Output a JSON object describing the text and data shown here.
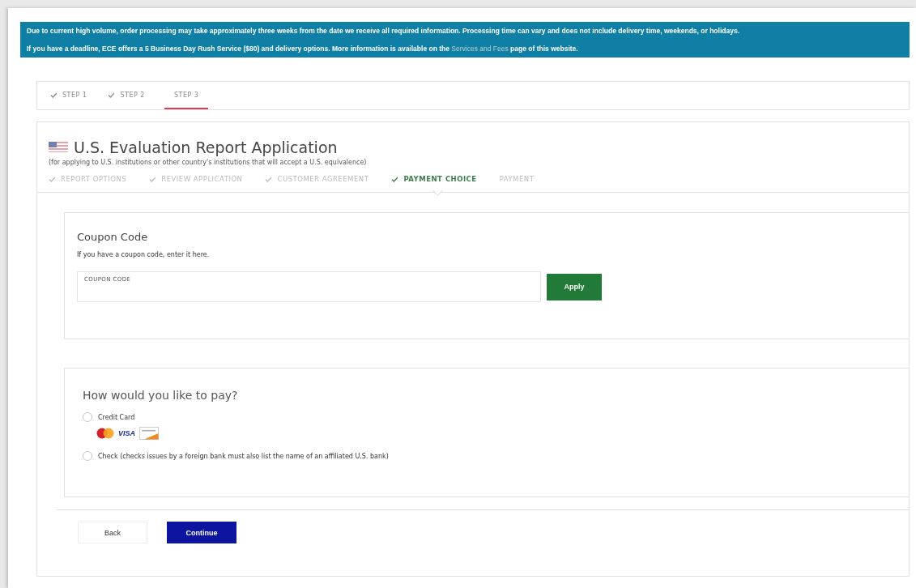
{
  "notice": {
    "lines": [
      [
        {
          "kind": "plain",
          "text": "Due to current high volume, order processing may take approximately three weeks from the date we receive all required information. Processing time can vary and does not include delivery time, weekends, or holidays."
        }
      ],
      [
        {
          "kind": "plain",
          "text": "If you have a deadline, ECE offers a 5 Business Day Rush Service ($80) and delivery options. More information is available on the "
        },
        {
          "kind": "link",
          "text": "Services and Fees"
        },
        {
          "kind": "plain",
          "text": " page of this website."
        }
      ]
    ]
  },
  "steps": [
    {
      "label": "STEP 1",
      "done": true,
      "selected": false
    },
    {
      "label": "STEP 2",
      "done": true,
      "selected": false
    },
    {
      "label": "STEP 3",
      "done": false,
      "selected": true
    }
  ],
  "application": {
    "title": "U.S. Evaluation Report Application",
    "subtitle": "(for applying to U.S. institutions or other country's institutions that will accept a U.S. equivalence)"
  },
  "progress": [
    {
      "label": "REPORT OPTIONS",
      "done": true,
      "selected": false
    },
    {
      "label": "REVIEW APPLICATION",
      "done": true,
      "selected": false
    },
    {
      "label": "CUSTOMER AGREEMENT",
      "done": true,
      "selected": false
    },
    {
      "label": "PAYMENT CHOICE",
      "done": true,
      "selected": true
    },
    {
      "label": "PAYMENT",
      "done": false,
      "selected": false
    }
  ],
  "coupon": {
    "title": "Coupon Code",
    "hint": "If you have a coupon code, enter it here.",
    "placeholder": "COUPON CODE",
    "button": "Apply"
  },
  "payment": {
    "title": "How would you like to pay?",
    "options": [
      {
        "label": "Credit Card",
        "selected": false,
        "cards": [
          {
            "kind": "mastercard"
          },
          {
            "kind": "visa",
            "label": "VISA"
          },
          {
            "kind": "discover"
          }
        ]
      },
      {
        "label": "Check (checks issues by a foreign bank must also list the name of an affiliated U.S. bank)",
        "selected": false
      }
    ]
  },
  "buttons": [
    {
      "kind": "secondary",
      "label": "Back"
    },
    {
      "kind": "primary",
      "label": "Continue"
    }
  ]
}
